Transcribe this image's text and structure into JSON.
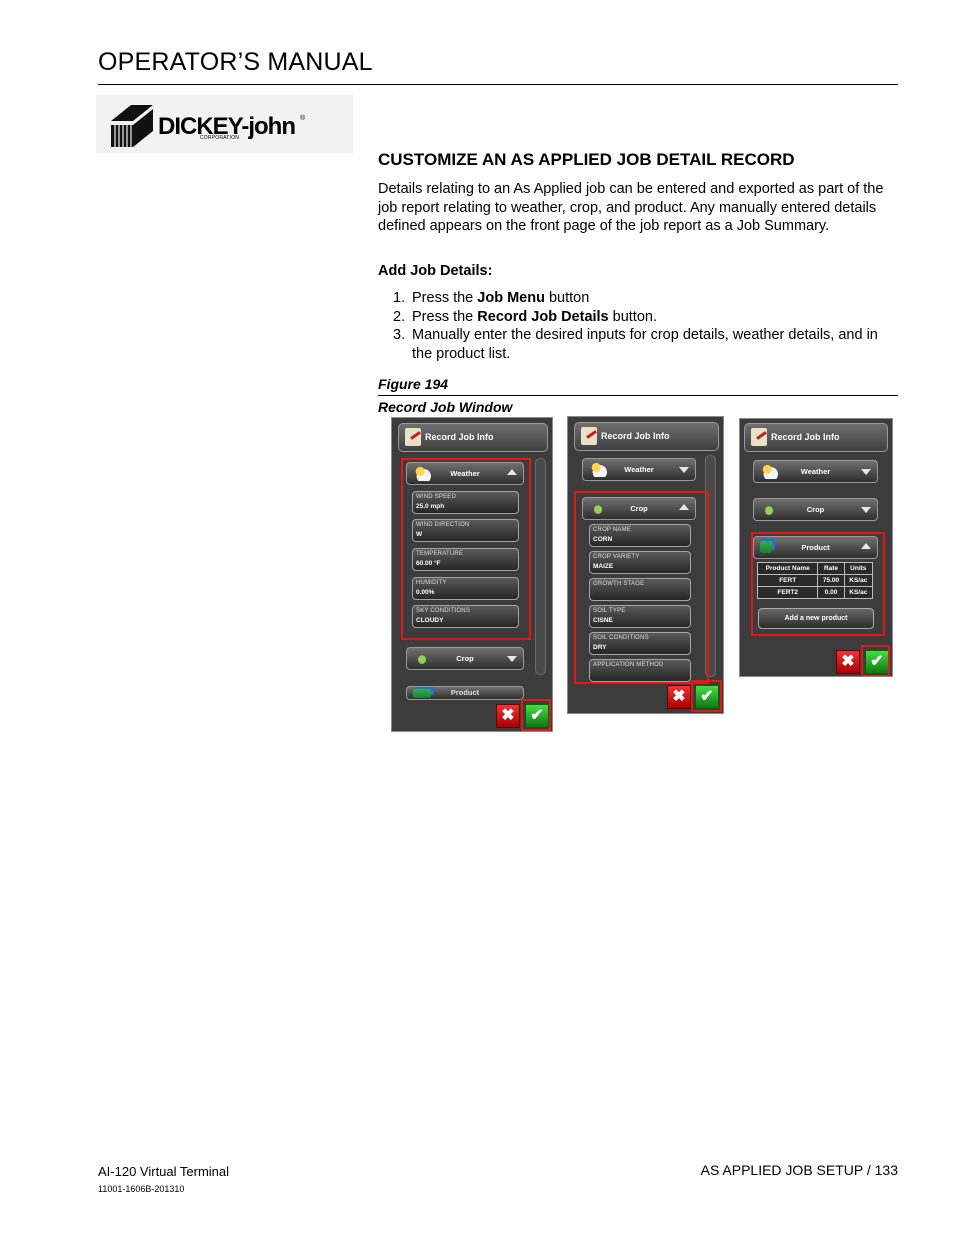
{
  "header": {
    "title": "OPERATOR’S MANUAL"
  },
  "logo": {
    "name": "DICKEY-john",
    "registered": "®",
    "corporation": "CORPORATION"
  },
  "section": {
    "title": "CUSTOMIZE AN AS APPLIED JOB DETAIL RECORD",
    "intro": "Details relating to an As Applied job can be entered and exported as part of the job report relating to weather, crop, and product. Any manually entered details defined appears on the front page of the job report as a Job Summary.",
    "add_heading": "Add Job Details:",
    "steps": [
      {
        "num": "1.",
        "pre": "Press the ",
        "bold": "Job Menu",
        "post": " button"
      },
      {
        "num": "2.",
        "pre": "Press the ",
        "bold": "Record Job Details",
        "post": " button."
      },
      {
        "num": "3.",
        "pre": "Manually enter the desired inputs for crop details, weather details, and in the product list.",
        "bold": "",
        "post": ""
      }
    ]
  },
  "figure": {
    "number": "Figure 194",
    "caption": "Record Job Window",
    "window_title": "Record Job Info",
    "weather_label": "Weather",
    "crop_label": "Crop",
    "product_label": "Product",
    "product_partial": "Product",
    "weather_fields": [
      {
        "label": "WIND SPEED",
        "value": "25.0 mph"
      },
      {
        "label": "WIND DIRECTION",
        "value": "W"
      },
      {
        "label": "TEMPERATURE",
        "value": "60.00 °F"
      },
      {
        "label": "HUMIDITY",
        "value": "0.00%"
      },
      {
        "label": "SKY CONDITIONS",
        "value": "CLOUDY"
      }
    ],
    "crop_fields": [
      {
        "label": "CROP NAME",
        "value": "CORN"
      },
      {
        "label": "CROP VARIETY",
        "value": "MAIZE"
      },
      {
        "label": "GROWTH STAGE",
        "value": ""
      },
      {
        "label": "SOIL TYPE",
        "value": "CISNE"
      },
      {
        "label": "SOIL CONDITIONS",
        "value": "DRY"
      },
      {
        "label": "APPLICATION METHOD",
        "value": ""
      }
    ],
    "product_table": {
      "headers": [
        "Product Name",
        "Rate",
        "Units"
      ],
      "rows": [
        [
          "FERT",
          "75.00",
          "KS/ac"
        ],
        [
          "FERT2",
          "0.00",
          "KS/ac"
        ]
      ]
    },
    "add_product_label": "Add a new product",
    "cancel_glyph": "✖",
    "accept_glyph": "✔"
  },
  "footer": {
    "product": "AI-120 Virtual Terminal",
    "doc_number": "11001-1606B-201310",
    "page": "AS APPLIED JOB SETUP / 133"
  }
}
